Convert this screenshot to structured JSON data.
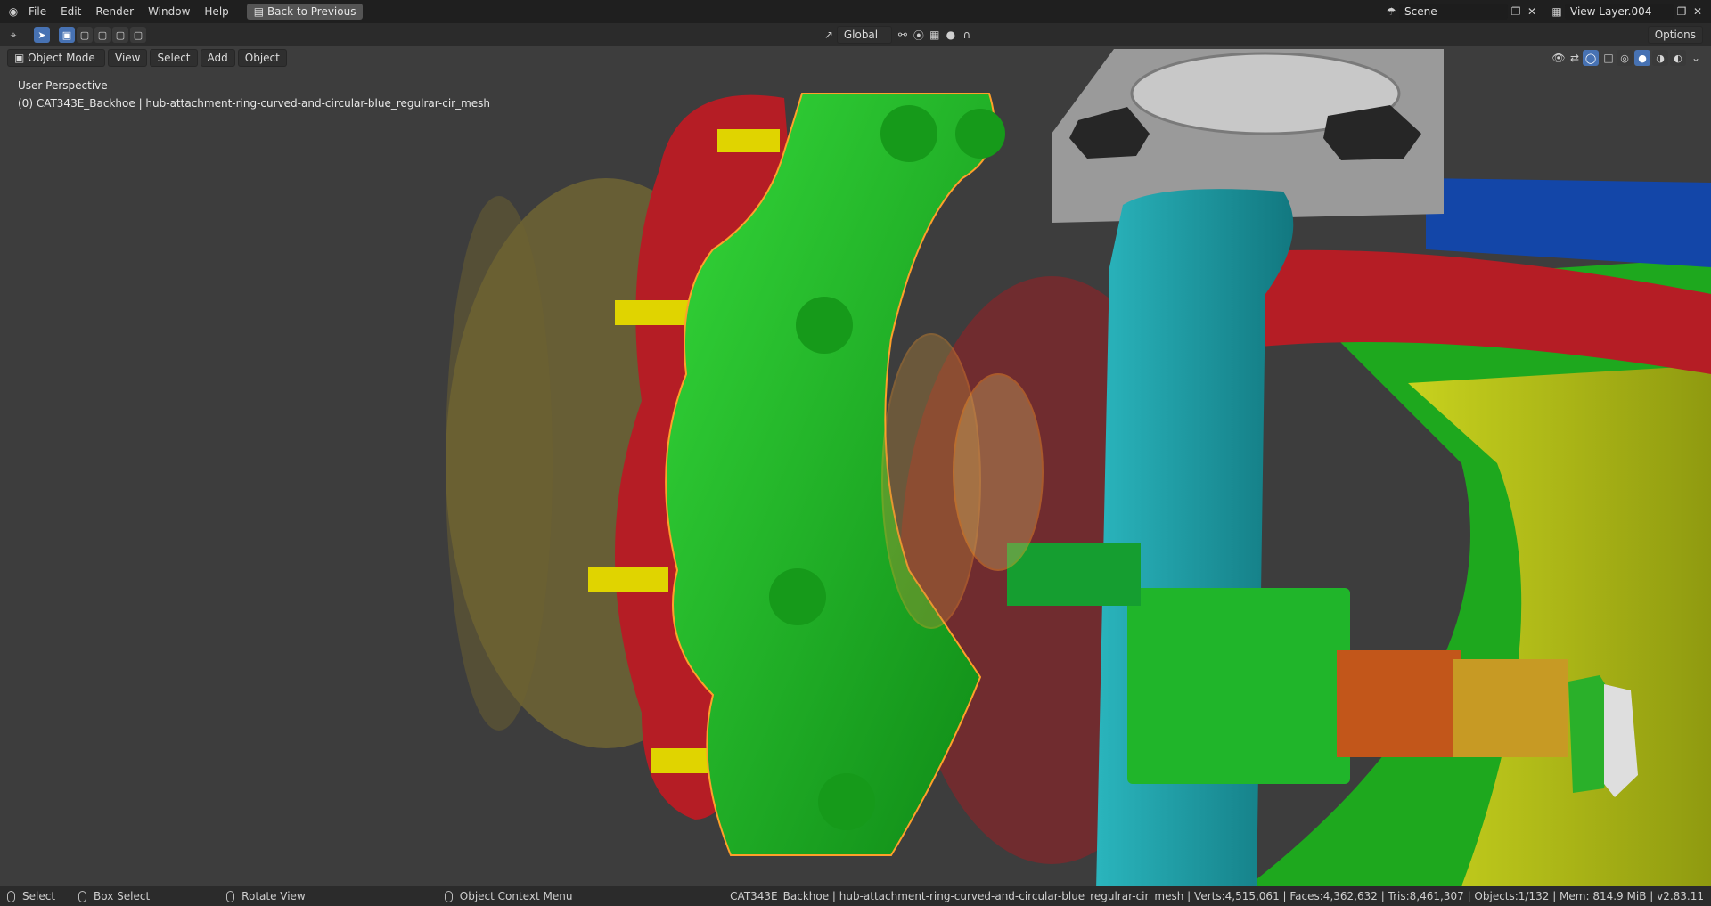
{
  "topbar": {
    "menus": [
      "File",
      "Edit",
      "Render",
      "Window",
      "Help"
    ],
    "back_button": "Back to Previous",
    "scene": "Scene",
    "view_layer": "View Layer.004"
  },
  "toolbar": {
    "orientation": "Global",
    "options_label": "Options"
  },
  "header": {
    "mode": "Object Mode",
    "menus": [
      "View",
      "Select",
      "Add",
      "Object"
    ]
  },
  "viewport": {
    "perspective": "User Perspective",
    "active_object": "(0) CAT343E_Backhoe | hub-attachment-ring-curved-and-circular-blue_regulrar-cir_mesh"
  },
  "statusbar": {
    "items": [
      "Select",
      "Box Select",
      "Rotate View",
      "Object Context Menu"
    ],
    "stats": "CAT343E_Backhoe | hub-attachment-ring-curved-and-circular-blue_regulrar-cir_mesh | Verts:4,515,061 | Faces:4,362,632 | Tris:8,461,307 | Objects:1/132 | Mem: 814.9 MiB | v2.83.11"
  },
  "colors": {
    "green": "#1ebd1e",
    "red": "#b51d25",
    "teal": "#1f9fa8",
    "yellow": "#b5c21a",
    "blue": "#1346a8",
    "selection_outline": "#ff9f2a",
    "accent": "#4772b3"
  }
}
